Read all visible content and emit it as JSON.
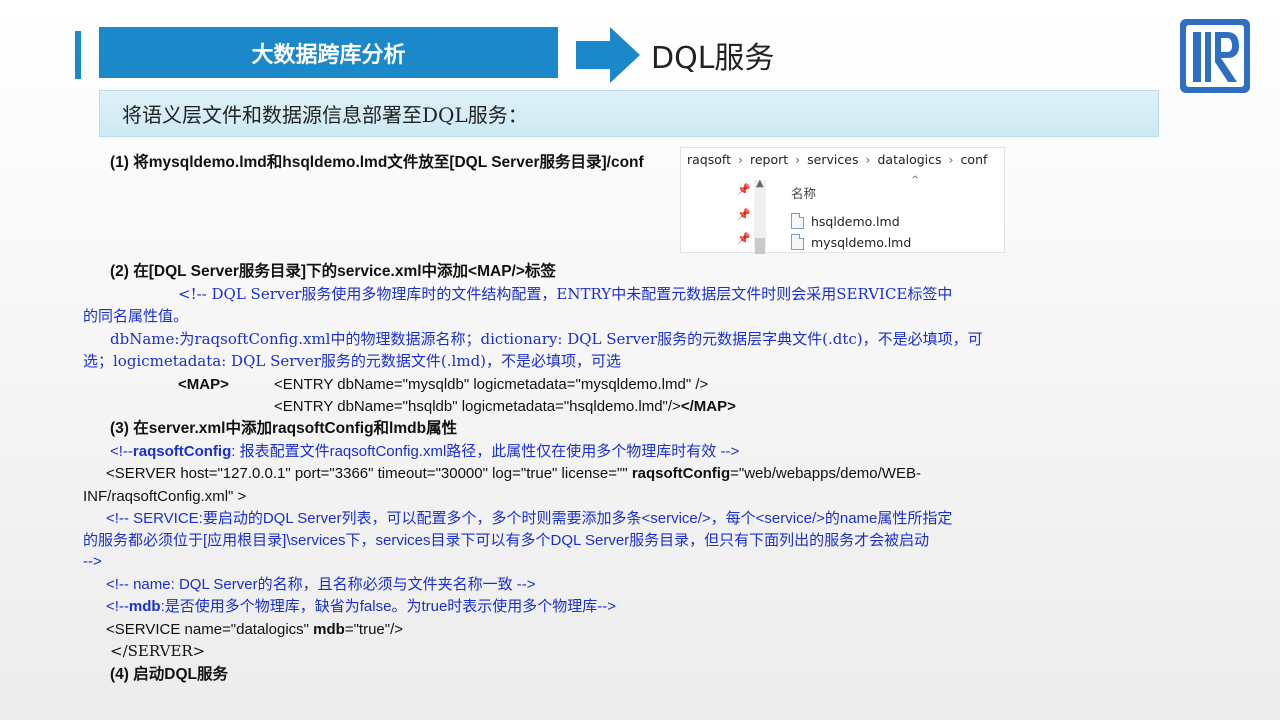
{
  "header": {
    "title": "大数据跨库分析",
    "heading": "DQL服务"
  },
  "subtitle": "将语义层文件和数据源信息部署至DQL服务：",
  "step1": "(1) 将mysqldemo.lmd和hsqldemo.lmd文件放至[DQL Server服务目录]/conf",
  "explorer": {
    "breadcrumb": [
      "raqsoft",
      "report",
      "services",
      "datalogics",
      "conf"
    ],
    "column_header": "名称",
    "files": [
      "hsqldemo.lmd",
      "mysqldemo.lmd"
    ]
  },
  "step2": "(2) 在[DQL Server服务目录]下的service.xml中添加<MAP/>标签",
  "comment1_a": "<!-- DQL Server服务使用多物理库时的文件结构配置，ENTRY中未配置元数据层文件时则会采用SERVICE标签中",
  "comment1_b": "的同名属性值。",
  "comment2_a": "dbName:为raqsoftConfig.xml中的物理数据源名称；dictionary: DQL Server服务的元数据层字典文件(.dtc)，不是必填项，可",
  "comment2_b": "选；logicmetadata: DQL Server服务的元数据文件(.lmd)，不是必填项，可选",
  "map_open": "<MAP>",
  "entry1": "<ENTRY dbName=\"mysqldb\" logicmetadata=\"mysqldemo.lmd\" />",
  "entry2": "<ENTRY dbName=\"hsqldb\" logicmetadata=\"hsqldemo.lmd\"/>",
  "map_close": "</MAP>",
  "step3": "(3) 在server.xml中添加raqsoftConfig和lmdb属性",
  "c3_open": "<!--",
  "c3_key": "raqsoftConfig",
  "c3_rest": ": 报表配置文件raqsoftConfig.xml路径，此属性仅在使用多个物理库时有效 -->",
  "server_pre": "<SERVER host=\"127.0.0.1\" port=\"3366\" timeout=\"30000\" log=\"true\" license=\"\" ",
  "server_key": "raqsoftConfig",
  "server_post": "=\"web/webapps/demo/WEB-",
  "server_line2": "INF/raqsoftConfig.xml\" >",
  "c4_a": "<!-- SERVICE:要启动的DQL Server列表，可以配置多个，多个时则需要添加多条<service/>，每个<service/>的name属性所指定",
  "c4_b": "的服务都必须位于[应用根目录]\\services下，services目录下可以有多个DQL Server服务目录，但只有下面列出的服务才会被启动",
  "c4_c": "-->",
  "c5": "<!-- name: DQL Server的名称，且名称必须与文件夹名称一致 -->",
  "c6_open": "<!--",
  "c6_key": "mdb",
  "c6_rest": ":是否使用多个物理库，缺省为false。为true时表示使用多个物理库-->",
  "service_pre": "<SERVICE name=\"datalogics\" ",
  "service_key": "mdb",
  "service_post": "=\"true\"/>",
  "server_close": "</SERVER>",
  "step4": "(4) 启动DQL服务",
  "colors": {
    "accent": "#1a88c9",
    "comment": "#1a2fd0",
    "subtitle_bg": "#d6edf6"
  }
}
